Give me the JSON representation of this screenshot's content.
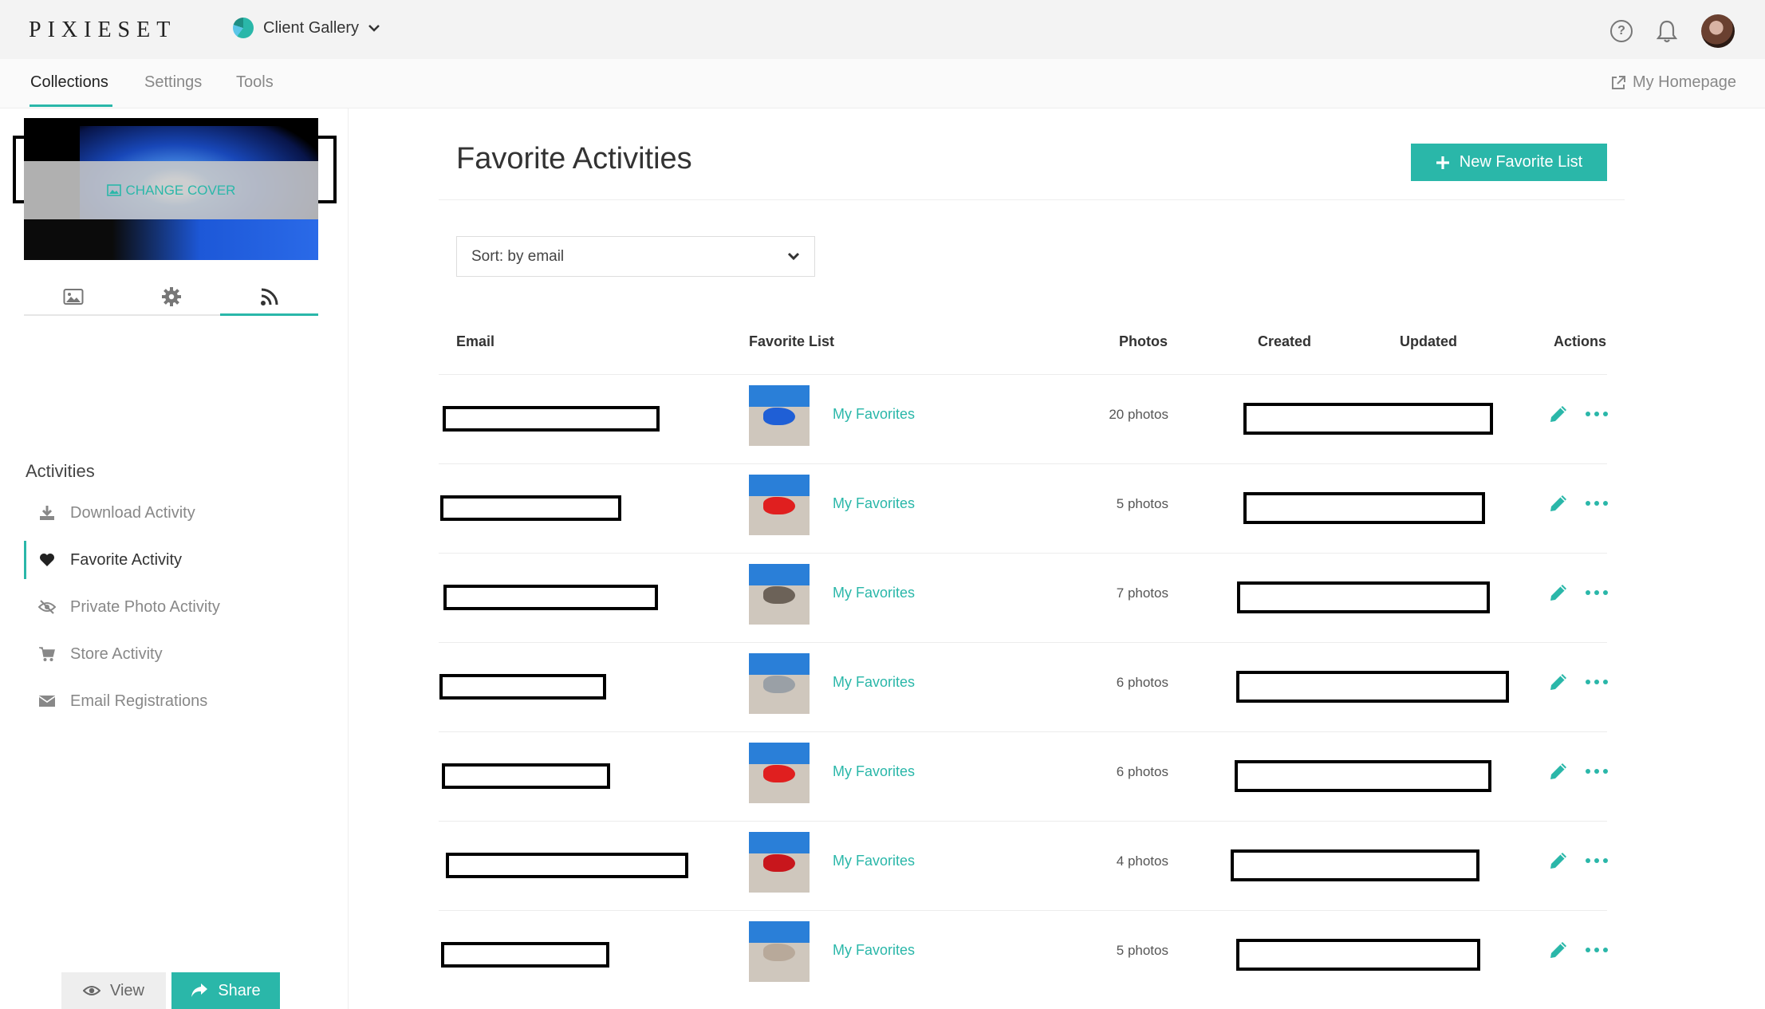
{
  "app": {
    "logo": "PIXIESET",
    "product": "Client Gallery"
  },
  "topbar": {
    "help_icon": "help-circle-icon",
    "notifications_icon": "bell-icon"
  },
  "subnav": {
    "tabs": [
      {
        "label": "Collections",
        "active": true
      },
      {
        "label": "Settings",
        "active": false
      },
      {
        "label": "Tools",
        "active": false
      }
    ],
    "homepage": "My Homepage"
  },
  "sidebar": {
    "change_cover": "CHANGE COVER",
    "tabs": [
      {
        "icon": "image-icon",
        "active": false
      },
      {
        "icon": "gear-icon",
        "active": false
      },
      {
        "icon": "activity-feed-icon",
        "active": true
      }
    ],
    "activities_title": "Activities",
    "menu": [
      {
        "label": "Download Activity",
        "icon": "download-icon",
        "active": false
      },
      {
        "label": "Favorite Activity",
        "icon": "heart-icon",
        "active": true
      },
      {
        "label": "Private Photo Activity",
        "icon": "eye-slash-icon",
        "active": false
      },
      {
        "label": "Store Activity",
        "icon": "cart-icon",
        "active": false
      },
      {
        "label": "Email Registrations",
        "icon": "envelope-icon",
        "active": false
      }
    ],
    "view_label": "View",
    "share_label": "Share"
  },
  "main": {
    "title": "Favorite Activities",
    "new_button": "New Favorite List",
    "sort": "Sort: by email",
    "columns": [
      "Email",
      "Favorite List",
      "Photos",
      "Created",
      "Updated",
      "Actions"
    ],
    "rows": [
      {
        "list": "My Favorites",
        "photos": "20 photos",
        "thumb_color": "#1f5fd6"
      },
      {
        "list": "My Favorites",
        "photos": "5 photos",
        "thumb_color": "#e01f1f"
      },
      {
        "list": "My Favorites",
        "photos": "7 photos",
        "thumb_color": "#6c6258"
      },
      {
        "list": "My Favorites",
        "photos": "6 photos",
        "thumb_color": "#9aa0a6"
      },
      {
        "list": "My Favorites",
        "photos": "6 photos",
        "thumb_color": "#e01f1f"
      },
      {
        "list": "My Favorites",
        "photos": "4 photos",
        "thumb_color": "#c8161c"
      },
      {
        "list": "My Favorites",
        "photos": "5 photos",
        "thumb_color": "#b8a99a"
      }
    ]
  },
  "colors": {
    "accent": "#2ab7a9"
  }
}
